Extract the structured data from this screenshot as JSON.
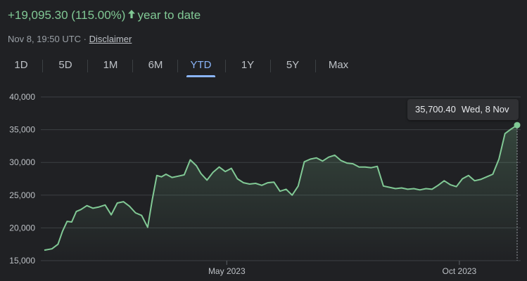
{
  "header": {
    "change_text": "+19,095.30 (115.00%)",
    "arrow_icon": "arrow-up-icon",
    "period_text": "year to date",
    "timestamp": "Nov 8, 19:50 UTC",
    "separator": "·",
    "disclaimer_label": "Disclaimer"
  },
  "colors": {
    "accent_green": "#81c995",
    "active_tab": "#8ab4f8",
    "background": "#202124"
  },
  "range_tabs": [
    {
      "label": "1D",
      "active": false
    },
    {
      "label": "5D",
      "active": false
    },
    {
      "label": "1M",
      "active": false
    },
    {
      "label": "6M",
      "active": false
    },
    {
      "label": "YTD",
      "active": true
    },
    {
      "label": "1Y",
      "active": false
    },
    {
      "label": "5Y",
      "active": false
    },
    {
      "label": "Max",
      "active": false
    }
  ],
  "tooltip": {
    "value": "35,700.40",
    "date": "Wed, 8 Nov"
  },
  "chart_data": {
    "type": "area",
    "title": "",
    "xlabel": "",
    "ylabel": "",
    "y_ticks": [
      "40,000",
      "35,000",
      "30,000",
      "25,000",
      "20,000",
      "15,000"
    ],
    "y_tick_values": [
      40000,
      35000,
      30000,
      25000,
      20000,
      15000
    ],
    "x_ticks": [
      {
        "label": "May 2023",
        "date": "2023-05-01"
      },
      {
        "label": "Oct 2023",
        "date": "2023-10-01"
      }
    ],
    "ylim": [
      15000,
      40000
    ],
    "xlim": [
      "2023-01-01",
      "2023-11-08"
    ],
    "grid": true,
    "series": [
      {
        "x": [
          "2023-01-01",
          "2023-01-06",
          "2023-01-10",
          "2023-01-13",
          "2023-01-16",
          "2023-01-19",
          "2023-01-22",
          "2023-01-25",
          "2023-01-29",
          "2023-02-02",
          "2023-02-06",
          "2023-02-10",
          "2023-02-14",
          "2023-02-18",
          "2023-02-22",
          "2023-02-26",
          "2023-03-02",
          "2023-03-06",
          "2023-03-10",
          "2023-03-13",
          "2023-03-16",
          "2023-03-19",
          "2023-03-22",
          "2023-03-26",
          "2023-03-30",
          "2023-04-03",
          "2023-04-07",
          "2023-04-11",
          "2023-04-14",
          "2023-04-18",
          "2023-04-22",
          "2023-04-26",
          "2023-04-30",
          "2023-05-04",
          "2023-05-08",
          "2023-05-12",
          "2023-05-16",
          "2023-05-20",
          "2023-05-24",
          "2023-05-28",
          "2023-06-01",
          "2023-06-05",
          "2023-06-09",
          "2023-06-13",
          "2023-06-17",
          "2023-06-21",
          "2023-06-25",
          "2023-06-29",
          "2023-07-03",
          "2023-07-07",
          "2023-07-11",
          "2023-07-15",
          "2023-07-19",
          "2023-07-23",
          "2023-07-27",
          "2023-07-31",
          "2023-08-04",
          "2023-08-08",
          "2023-08-12",
          "2023-08-16",
          "2023-08-20",
          "2023-08-24",
          "2023-08-28",
          "2023-09-01",
          "2023-09-05",
          "2023-09-09",
          "2023-09-13",
          "2023-09-17",
          "2023-09-21",
          "2023-09-25",
          "2023-09-29",
          "2023-10-03",
          "2023-10-07",
          "2023-10-11",
          "2023-10-15",
          "2023-10-19",
          "2023-10-23",
          "2023-10-27",
          "2023-10-31",
          "2023-11-04",
          "2023-11-08"
        ],
        "y": [
          16600,
          16800,
          17500,
          19500,
          21000,
          20900,
          22500,
          22800,
          23400,
          23000,
          23200,
          23500,
          22000,
          23800,
          24000,
          23300,
          22300,
          21900,
          20100,
          24300,
          28000,
          27800,
          28200,
          27700,
          27900,
          28100,
          30400,
          29500,
          28300,
          27300,
          28500,
          29300,
          28600,
          29100,
          27500,
          26900,
          26700,
          26800,
          26500,
          26900,
          27000,
          25600,
          25900,
          25000,
          26400,
          30100,
          30500,
          30700,
          30200,
          30800,
          31100,
          30300,
          29900,
          29800,
          29300,
          29300,
          29200,
          29400,
          26400,
          26200,
          26000,
          26100,
          25900,
          26000,
          25800,
          26000,
          25900,
          26500,
          27200,
          26600,
          26300,
          27500,
          28000,
          27200,
          27400,
          27800,
          28200,
          30500,
          34400,
          35100,
          35700
        ]
      }
    ]
  }
}
